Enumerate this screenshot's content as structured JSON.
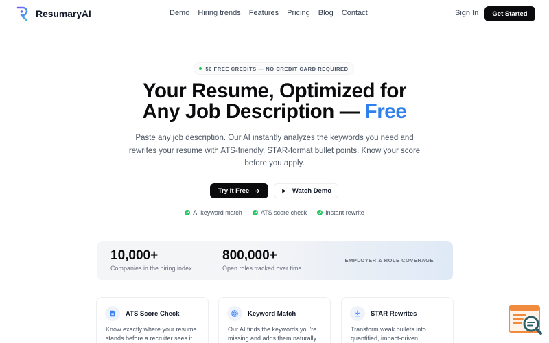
{
  "nav": {
    "brand": "ResumaryAI",
    "links": [
      "Demo",
      "Hiring trends",
      "Features",
      "Pricing",
      "Blog",
      "Contact"
    ],
    "signin": "Sign In",
    "cta": "Get Started"
  },
  "hero": {
    "pill": "50 FREE CREDITS — NO CREDIT CARD REQUIRED",
    "title_line1": "Your Resume, Optimized for",
    "title_line2": "Any Job Description —",
    "title_accent": "Free",
    "subtitle": "Paste any job description. Our AI instantly analyzes the keywords you need and rewrites your resume with ATS-friendly, STAR-format bullet points. Know your score before you apply.",
    "primary_cta": "Try It Free",
    "secondary_cta": "Watch Demo",
    "checks": [
      "AI keyword match",
      "ATS score check",
      "Instant rewrite"
    ]
  },
  "stats": {
    "items": [
      {
        "value": "10,000+",
        "label": "Companies in the hiring index"
      },
      {
        "value": "800,000+",
        "label": "Open roles tracked over time"
      }
    ],
    "tag": "EMPLOYER & ROLE COVERAGE"
  },
  "features": [
    {
      "icon": "document-icon",
      "title": "ATS Score Check",
      "desc": "Know exactly where your resume stands before a recruiter sees it."
    },
    {
      "icon": "target-icon",
      "title": "Keyword Match",
      "desc": "Our AI finds the keywords you're missing and adds them naturally."
    },
    {
      "icon": "download-icon",
      "title": "STAR Rewrites",
      "desc": "Transform weak bullets into quantified, impact-driven"
    }
  ],
  "colors": {
    "accent": "#2f80ed",
    "primary_button": "#0b0b0d",
    "check_green": "#22c55e",
    "widget_orange": "#f08a3c",
    "widget_teal": "#2c5f66"
  }
}
